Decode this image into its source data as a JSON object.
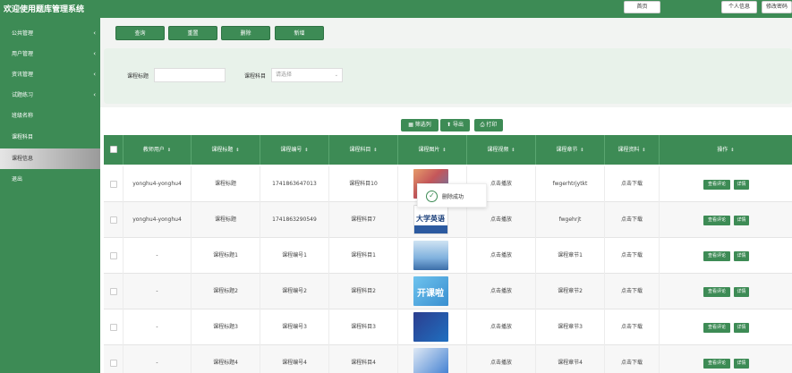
{
  "header": {
    "title": "欢迎使用题库管理系统",
    "home": "首页",
    "profile": "个人信息",
    "change_password": "修改密码"
  },
  "sidebar": {
    "items": [
      {
        "label": "公共管理",
        "has_children": true
      },
      {
        "label": "用户管理",
        "has_children": true
      },
      {
        "label": "资讯管理",
        "has_children": true
      },
      {
        "label": "试题练习",
        "has_children": true
      },
      {
        "label": "班级名称",
        "has_children": false
      },
      {
        "label": "课程科目",
        "has_children": false
      },
      {
        "label": "课程信息",
        "has_children": false,
        "active": true
      },
      {
        "label": "退出",
        "has_children": false
      }
    ]
  },
  "actions": {
    "query": "查询",
    "reset": "重置",
    "delete": "删除",
    "add": "新增"
  },
  "search": {
    "title_label": "课程标题",
    "title_value": "",
    "subject_label": "课程科目",
    "subject_placeholder": "请选择"
  },
  "toolbar": {
    "filter_columns": "筛选列",
    "export": "导出",
    "print": "打印"
  },
  "table": {
    "columns": [
      "教师用户",
      "课程标题",
      "课程编号",
      "课程科目",
      "课程图片",
      "课程视频",
      "课程章节",
      "课程资料",
      "操作"
    ],
    "rows": [
      {
        "teacher": "yonghu4-yonghu4",
        "title": "课程标题",
        "code": "1741863647013",
        "subject": "课程科目10",
        "video": "点击播放",
        "chapter": "fwgerhtrjytkt",
        "material": "点击下载"
      },
      {
        "teacher": "yonghu4-yonghu4",
        "title": "课程标题",
        "code": "1741863290549",
        "subject": "课程科目7",
        "video": "点击播放",
        "chapter": "fwgehrjt",
        "material": "点击下载"
      },
      {
        "teacher": "-",
        "title": "课程标题1",
        "code": "课程编号1",
        "subject": "课程科目1",
        "video": "点击播放",
        "chapter": "课程章节1",
        "material": "点击下载"
      },
      {
        "teacher": "-",
        "title": "课程标题2",
        "code": "课程编号2",
        "subject": "课程科目2",
        "video": "点击播放",
        "chapter": "课程章节2",
        "material": "点击下载"
      },
      {
        "teacher": "-",
        "title": "课程标题3",
        "code": "课程编号3",
        "subject": "课程科目3",
        "video": "点击播放",
        "chapter": "课程章节3",
        "material": "点击下载"
      },
      {
        "teacher": "-",
        "title": "课程标题4",
        "code": "课程编号4",
        "subject": "课程科目4",
        "video": "点击播放",
        "chapter": "课程章节4",
        "material": "点击下载"
      }
    ],
    "row_actions": {
      "view_comments": "查看评论",
      "detail": "详情"
    },
    "thumb_text": {
      "row2_line1": "大学英语",
      "row4_line1": "开课啦"
    }
  },
  "toast": {
    "message": "删除成功"
  },
  "colors": {
    "primary": "#3d8b55",
    "panel": "#e8f2ea"
  }
}
